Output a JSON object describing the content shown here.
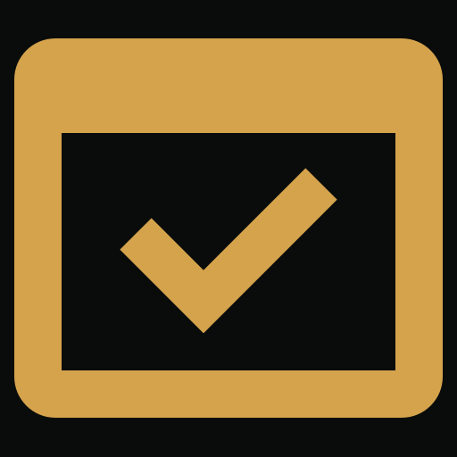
{
  "icon": {
    "name": "window-check-icon",
    "colors": {
      "background": "#0a0c0b",
      "accent": "#d4a34c",
      "inner": "#0a0c0b"
    }
  }
}
